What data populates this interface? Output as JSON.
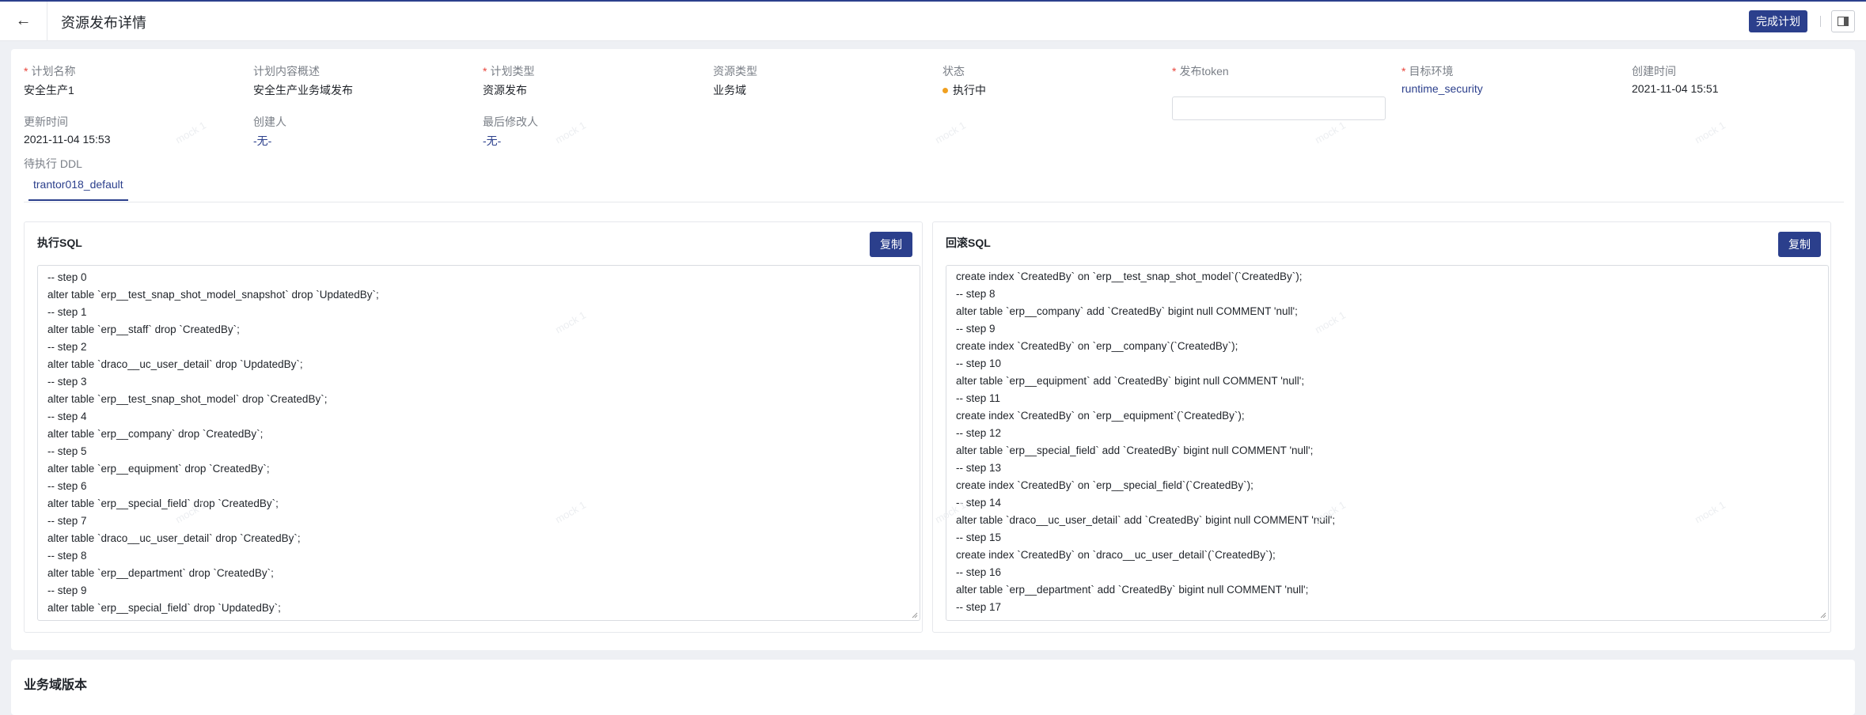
{
  "header": {
    "title": "资源发布详情",
    "back_icon": "←",
    "complete_label": "完成计划"
  },
  "watermark": "mock 1",
  "info": {
    "plan_name": {
      "label": "计划名称",
      "required": "*",
      "value": "安全生产1"
    },
    "plan_summary": {
      "label": "计划内容概述",
      "value": "安全生产业务域发布"
    },
    "plan_type": {
      "label": "计划类型",
      "required": "*",
      "value": "资源发布"
    },
    "resource_type": {
      "label": "资源类型",
      "value": "业务域"
    },
    "status": {
      "label": "状态",
      "value": "执行中",
      "color": "#f0a020"
    },
    "token": {
      "label": "发布token",
      "required": "*",
      "value": ""
    },
    "target_env": {
      "label": "目标环境",
      "required": "*",
      "value": "runtime_security"
    },
    "created_time": {
      "label": "创建时间",
      "value": "2021-11-04 15:51"
    },
    "updated_time": {
      "label": "更新时间",
      "value": "2021-11-04 15:53"
    },
    "creator": {
      "label": "创建人",
      "value": "-无-"
    },
    "last_modifier": {
      "label": "最后修改人",
      "value": "-无-"
    }
  },
  "ddl": {
    "label": "待执行 DDL",
    "tabs": [
      "trantor018_default"
    ]
  },
  "exec_sql": {
    "title": "执行SQL",
    "copy_label": "复制",
    "lines": [
      "-- step 0",
      "alter table `erp__test_snap_shot_model_snapshot` drop `UpdatedBy`;",
      "-- step 1",
      "alter table `erp__staff` drop `CreatedBy`;",
      "-- step 2",
      "alter table `draco__uc_user_detail` drop `UpdatedBy`;",
      "-- step 3",
      "alter table `erp__test_snap_shot_model` drop `CreatedBy`;",
      "-- step 4",
      "alter table `erp__company` drop `CreatedBy`;",
      "-- step 5",
      "alter table `erp__equipment` drop `CreatedBy`;",
      "-- step 6",
      "alter table `erp__special_field` drop `CreatedBy`;",
      "-- step 7",
      "alter table `draco__uc_user_detail` drop `CreatedBy`;",
      "-- step 8",
      "alter table `erp__department` drop `CreatedBy`;",
      "-- step 9",
      "alter table `erp__special_field` drop `UpdatedBy`;"
    ]
  },
  "rollback_sql": {
    "title": "回滚SQL",
    "copy_label": "复制",
    "lines": [
      "create index `CreatedBy` on `erp__test_snap_shot_model`(`CreatedBy`);",
      "-- step 8",
      "alter table `erp__company` add `CreatedBy` bigint null COMMENT 'null';",
      "-- step 9",
      "create index `CreatedBy` on `erp__company`(`CreatedBy`);",
      "-- step 10",
      "alter table `erp__equipment` add `CreatedBy` bigint null COMMENT 'null';",
      "-- step 11",
      "create index `CreatedBy` on `erp__equipment`(`CreatedBy`);",
      "-- step 12",
      "alter table `erp__special_field` add `CreatedBy` bigint null COMMENT 'null';",
      "-- step 13",
      "create index `CreatedBy` on `erp__special_field`(`CreatedBy`);",
      "-- step 14",
      "alter table `draco__uc_user_detail` add `CreatedBy` bigint null COMMENT 'null';",
      "-- step 15",
      "create index `CreatedBy` on `draco__uc_user_detail`(`CreatedBy`);",
      "-- step 16",
      "alter table `erp__department` add `CreatedBy` bigint null COMMENT 'null';",
      "-- step 17"
    ]
  },
  "domain_version": {
    "title": "业务域版本"
  }
}
